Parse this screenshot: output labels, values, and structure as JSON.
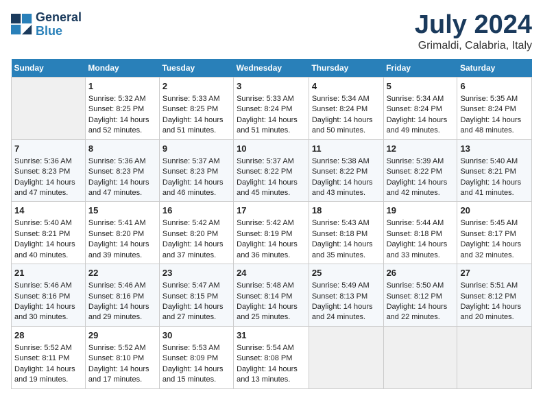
{
  "header": {
    "logo_line1": "General",
    "logo_line2": "Blue",
    "title": "July 2024",
    "subtitle": "Grimaldi, Calabria, Italy"
  },
  "days_of_week": [
    "Sunday",
    "Monday",
    "Tuesday",
    "Wednesday",
    "Thursday",
    "Friday",
    "Saturday"
  ],
  "weeks": [
    [
      {
        "num": "",
        "empty": true
      },
      {
        "num": "1",
        "sunrise": "Sunrise: 5:32 AM",
        "sunset": "Sunset: 8:25 PM",
        "daylight": "Daylight: 14 hours and 52 minutes."
      },
      {
        "num": "2",
        "sunrise": "Sunrise: 5:33 AM",
        "sunset": "Sunset: 8:25 PM",
        "daylight": "Daylight: 14 hours and 51 minutes."
      },
      {
        "num": "3",
        "sunrise": "Sunrise: 5:33 AM",
        "sunset": "Sunset: 8:24 PM",
        "daylight": "Daylight: 14 hours and 51 minutes."
      },
      {
        "num": "4",
        "sunrise": "Sunrise: 5:34 AM",
        "sunset": "Sunset: 8:24 PM",
        "daylight": "Daylight: 14 hours and 50 minutes."
      },
      {
        "num": "5",
        "sunrise": "Sunrise: 5:34 AM",
        "sunset": "Sunset: 8:24 PM",
        "daylight": "Daylight: 14 hours and 49 minutes."
      },
      {
        "num": "6",
        "sunrise": "Sunrise: 5:35 AM",
        "sunset": "Sunset: 8:24 PM",
        "daylight": "Daylight: 14 hours and 48 minutes."
      }
    ],
    [
      {
        "num": "7",
        "sunrise": "Sunrise: 5:36 AM",
        "sunset": "Sunset: 8:23 PM",
        "daylight": "Daylight: 14 hours and 47 minutes."
      },
      {
        "num": "8",
        "sunrise": "Sunrise: 5:36 AM",
        "sunset": "Sunset: 8:23 PM",
        "daylight": "Daylight: 14 hours and 47 minutes."
      },
      {
        "num": "9",
        "sunrise": "Sunrise: 5:37 AM",
        "sunset": "Sunset: 8:23 PM",
        "daylight": "Daylight: 14 hours and 46 minutes."
      },
      {
        "num": "10",
        "sunrise": "Sunrise: 5:37 AM",
        "sunset": "Sunset: 8:22 PM",
        "daylight": "Daylight: 14 hours and 45 minutes."
      },
      {
        "num": "11",
        "sunrise": "Sunrise: 5:38 AM",
        "sunset": "Sunset: 8:22 PM",
        "daylight": "Daylight: 14 hours and 43 minutes."
      },
      {
        "num": "12",
        "sunrise": "Sunrise: 5:39 AM",
        "sunset": "Sunset: 8:22 PM",
        "daylight": "Daylight: 14 hours and 42 minutes."
      },
      {
        "num": "13",
        "sunrise": "Sunrise: 5:40 AM",
        "sunset": "Sunset: 8:21 PM",
        "daylight": "Daylight: 14 hours and 41 minutes."
      }
    ],
    [
      {
        "num": "14",
        "sunrise": "Sunrise: 5:40 AM",
        "sunset": "Sunset: 8:21 PM",
        "daylight": "Daylight: 14 hours and 40 minutes."
      },
      {
        "num": "15",
        "sunrise": "Sunrise: 5:41 AM",
        "sunset": "Sunset: 8:20 PM",
        "daylight": "Daylight: 14 hours and 39 minutes."
      },
      {
        "num": "16",
        "sunrise": "Sunrise: 5:42 AM",
        "sunset": "Sunset: 8:20 PM",
        "daylight": "Daylight: 14 hours and 37 minutes."
      },
      {
        "num": "17",
        "sunrise": "Sunrise: 5:42 AM",
        "sunset": "Sunset: 8:19 PM",
        "daylight": "Daylight: 14 hours and 36 minutes."
      },
      {
        "num": "18",
        "sunrise": "Sunrise: 5:43 AM",
        "sunset": "Sunset: 8:18 PM",
        "daylight": "Daylight: 14 hours and 35 minutes."
      },
      {
        "num": "19",
        "sunrise": "Sunrise: 5:44 AM",
        "sunset": "Sunset: 8:18 PM",
        "daylight": "Daylight: 14 hours and 33 minutes."
      },
      {
        "num": "20",
        "sunrise": "Sunrise: 5:45 AM",
        "sunset": "Sunset: 8:17 PM",
        "daylight": "Daylight: 14 hours and 32 minutes."
      }
    ],
    [
      {
        "num": "21",
        "sunrise": "Sunrise: 5:46 AM",
        "sunset": "Sunset: 8:16 PM",
        "daylight": "Daylight: 14 hours and 30 minutes."
      },
      {
        "num": "22",
        "sunrise": "Sunrise: 5:46 AM",
        "sunset": "Sunset: 8:16 PM",
        "daylight": "Daylight: 14 hours and 29 minutes."
      },
      {
        "num": "23",
        "sunrise": "Sunrise: 5:47 AM",
        "sunset": "Sunset: 8:15 PM",
        "daylight": "Daylight: 14 hours and 27 minutes."
      },
      {
        "num": "24",
        "sunrise": "Sunrise: 5:48 AM",
        "sunset": "Sunset: 8:14 PM",
        "daylight": "Daylight: 14 hours and 25 minutes."
      },
      {
        "num": "25",
        "sunrise": "Sunrise: 5:49 AM",
        "sunset": "Sunset: 8:13 PM",
        "daylight": "Daylight: 14 hours and 24 minutes."
      },
      {
        "num": "26",
        "sunrise": "Sunrise: 5:50 AM",
        "sunset": "Sunset: 8:12 PM",
        "daylight": "Daylight: 14 hours and 22 minutes."
      },
      {
        "num": "27",
        "sunrise": "Sunrise: 5:51 AM",
        "sunset": "Sunset: 8:12 PM",
        "daylight": "Daylight: 14 hours and 20 minutes."
      }
    ],
    [
      {
        "num": "28",
        "sunrise": "Sunrise: 5:52 AM",
        "sunset": "Sunset: 8:11 PM",
        "daylight": "Daylight: 14 hours and 19 minutes."
      },
      {
        "num": "29",
        "sunrise": "Sunrise: 5:52 AM",
        "sunset": "Sunset: 8:10 PM",
        "daylight": "Daylight: 14 hours and 17 minutes."
      },
      {
        "num": "30",
        "sunrise": "Sunrise: 5:53 AM",
        "sunset": "Sunset: 8:09 PM",
        "daylight": "Daylight: 14 hours and 15 minutes."
      },
      {
        "num": "31",
        "sunrise": "Sunrise: 5:54 AM",
        "sunset": "Sunset: 8:08 PM",
        "daylight": "Daylight: 14 hours and 13 minutes."
      },
      {
        "num": "",
        "empty": true
      },
      {
        "num": "",
        "empty": true
      },
      {
        "num": "",
        "empty": true
      }
    ]
  ]
}
